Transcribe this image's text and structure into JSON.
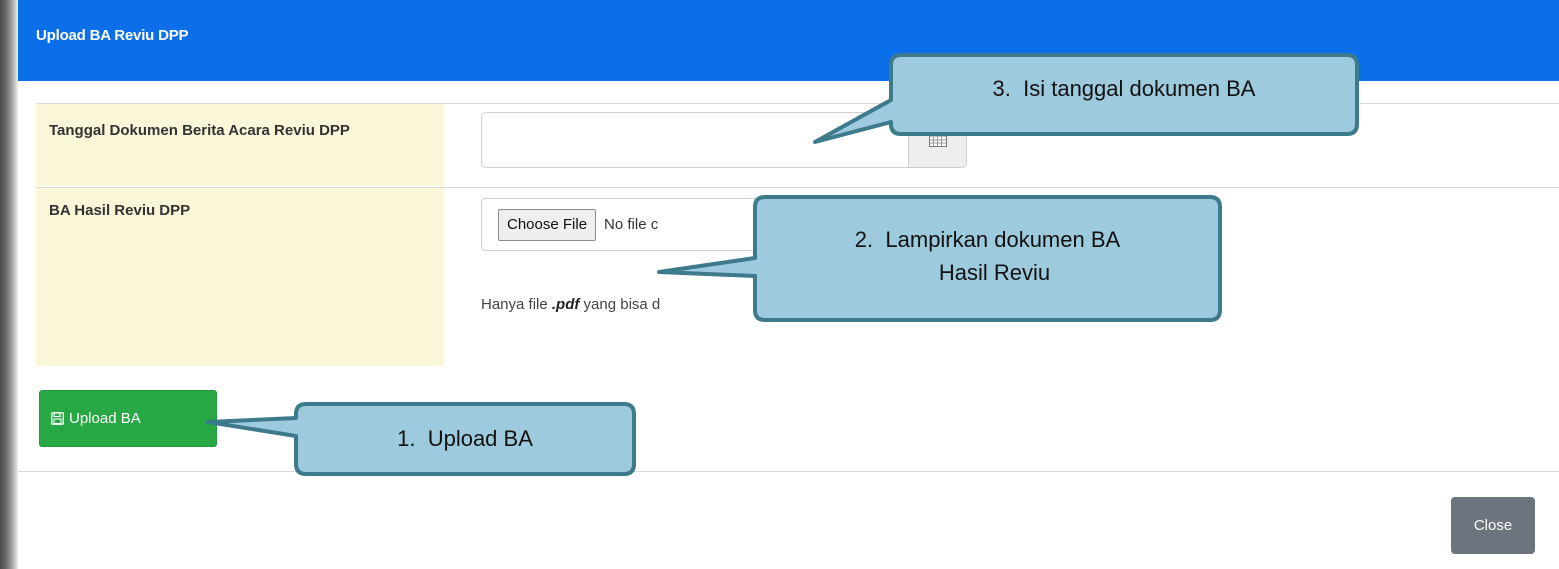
{
  "modal": {
    "title": "Upload BA Reviu DPP"
  },
  "form": {
    "date_label": "Tanggal Dokumen Berita Acara Reviu DPP",
    "date_value": "",
    "file_label": "BA Hasil Reviu DPP",
    "choose_file_label": "Choose File",
    "file_status": "No file c",
    "help_prefix": "Hanya file ",
    "help_ext": ".pdf",
    "help_suffix": " yang bisa d"
  },
  "buttons": {
    "upload_label": "Upload BA",
    "close_label": "Close"
  },
  "callouts": [
    {
      "number": "3.",
      "text": "Isi tanggal dokumen BA"
    },
    {
      "number": "2.",
      "line1": "Lampirkan dokumen BA",
      "line2": "Hasil Reviu"
    },
    {
      "number": "1.",
      "text": "Upload BA"
    }
  ],
  "icons": {
    "calendar": "calendar-icon",
    "save": "save-icon"
  },
  "colors": {
    "header": "#0a6fe8",
    "label_bg": "#fbf6d8",
    "upload_btn": "#28a745",
    "close_btn": "#6c757d",
    "callout_fill": "#9dcbdd",
    "callout_border": "#3c7a8c"
  }
}
